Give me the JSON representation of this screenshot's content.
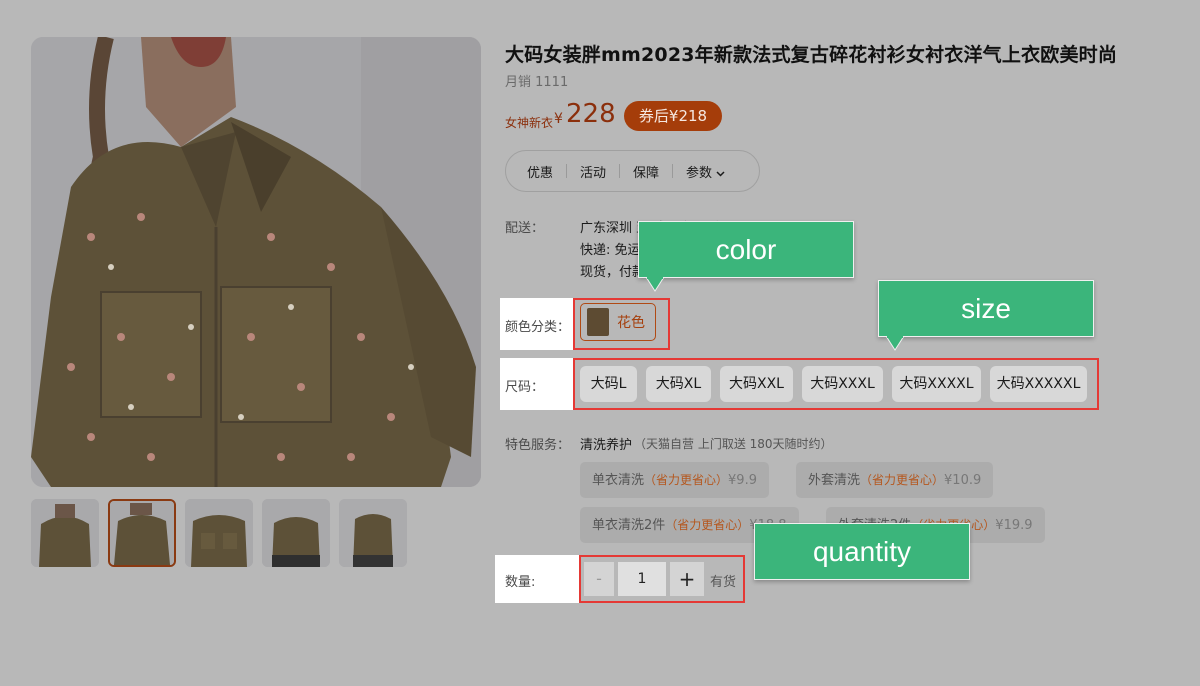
{
  "product": {
    "title": "大码女装胖mm2023年新款法式复古碎花衬衫女衬衣洋气上衣欧美时尚",
    "sales": "月销 1111",
    "price_tag": "女神新衣",
    "currency": "¥",
    "price": "228",
    "coupon": "券后¥218"
  },
  "tabs": [
    {
      "label": "优惠"
    },
    {
      "label": "活动"
    },
    {
      "label": "保障"
    },
    {
      "label": "参数"
    }
  ],
  "delivery": {
    "label": "配送：",
    "line1": "广东深圳 至 成都市 双流区",
    "line2": "快递: 免运费",
    "line3": "现货，付款后48小时内发货"
  },
  "color": {
    "label": "颜色分类：",
    "option": "花色"
  },
  "size": {
    "label": "尺码：",
    "options": [
      "大码L",
      "大码XL",
      "大码XXL",
      "大码XXXL",
      "大码XXXXL",
      "大码XXXXXL"
    ]
  },
  "services": {
    "label": "特色服务：",
    "name": "清洗养护",
    "desc": "（天猫自营 上门取送 180天随时约）",
    "items": [
      {
        "name": "单衣清洗",
        "hint": "（省力更省心）",
        "price": "¥9.9"
      },
      {
        "name": "外套清洗",
        "hint": "（省力更省心）",
        "price": "¥10.9"
      },
      {
        "name": "单衣清洗2件",
        "hint": "（省力更省心）",
        "price": "¥18.8"
      },
      {
        "name": "外套清洗2件",
        "hint": "（省力更省心）",
        "price": "¥19.9"
      }
    ]
  },
  "quantity": {
    "label": "数量:",
    "minus": "-",
    "value": "1",
    "plus": "+",
    "stock": "有货"
  },
  "callouts": {
    "color": "color",
    "size": "size",
    "quantity": "quantity"
  },
  "colors": {
    "accent": "#a53d0a",
    "callout": "#3bb57b",
    "highlight_border": "#e53935"
  }
}
